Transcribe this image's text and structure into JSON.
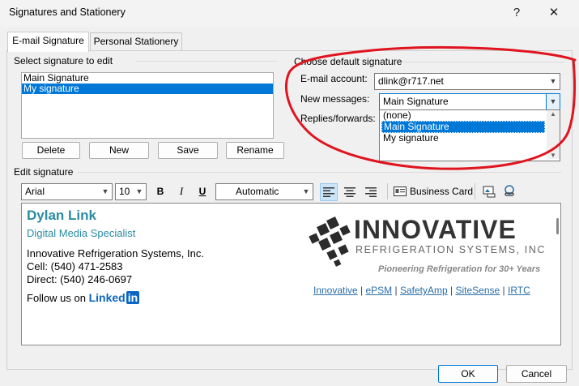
{
  "window": {
    "title": "Signatures and Stationery",
    "help_label": "?",
    "close_label": "✕"
  },
  "tabs": [
    {
      "label": "E-mail Signature"
    },
    {
      "label": "Personal Stationery"
    }
  ],
  "select_section": {
    "label": "Select signature to edit",
    "items": [
      "Main Signature",
      "My signature"
    ],
    "buttons": {
      "delete": "Delete",
      "new": "New",
      "save": "Save",
      "rename": "Rename"
    }
  },
  "default_section": {
    "label": "Choose default signature",
    "email_account_label": "E-mail account:",
    "email_account_value": "dlink@r717.net",
    "new_messages_label": "New messages:",
    "new_messages_value": "Main Signature",
    "replies_label": "Replies/forwards:",
    "dropdown_options": [
      "(none)",
      "Main Signature",
      "My signature"
    ]
  },
  "edit_section": {
    "label": "Edit signature",
    "font": "Arial",
    "size": "10",
    "bold": "B",
    "italic": "I",
    "underline": "U",
    "color": "Automatic",
    "business_card": "Business Card"
  },
  "signature": {
    "name": "Dylan Link",
    "job_title": "Digital Media Specialist",
    "company": "Innovative Refrigeration Systems, Inc.",
    "cell": "Cell: (540) 471-2583",
    "direct": "Direct: (540) 246-0697",
    "follow_text": "Follow us on",
    "linkedin_word": "Linked",
    "linkedin_in": "in",
    "logo_main": "INNOVATIVE",
    "logo_sub": "REFRIGERATION SYSTEMS, INC",
    "tagline": "Pioneering Refrigeration for 30+ Years",
    "links": [
      "Innovative",
      "ePSM",
      "SafetyAmp",
      "SiteSense",
      "IRTC"
    ]
  },
  "footer": {
    "ok": "OK",
    "cancel": "Cancel"
  },
  "colors": {
    "accent": "#0078d7",
    "name_teal": "#2a8ca0",
    "annotation_red": "#e0141e",
    "link_blue": "#2a6ea6"
  }
}
